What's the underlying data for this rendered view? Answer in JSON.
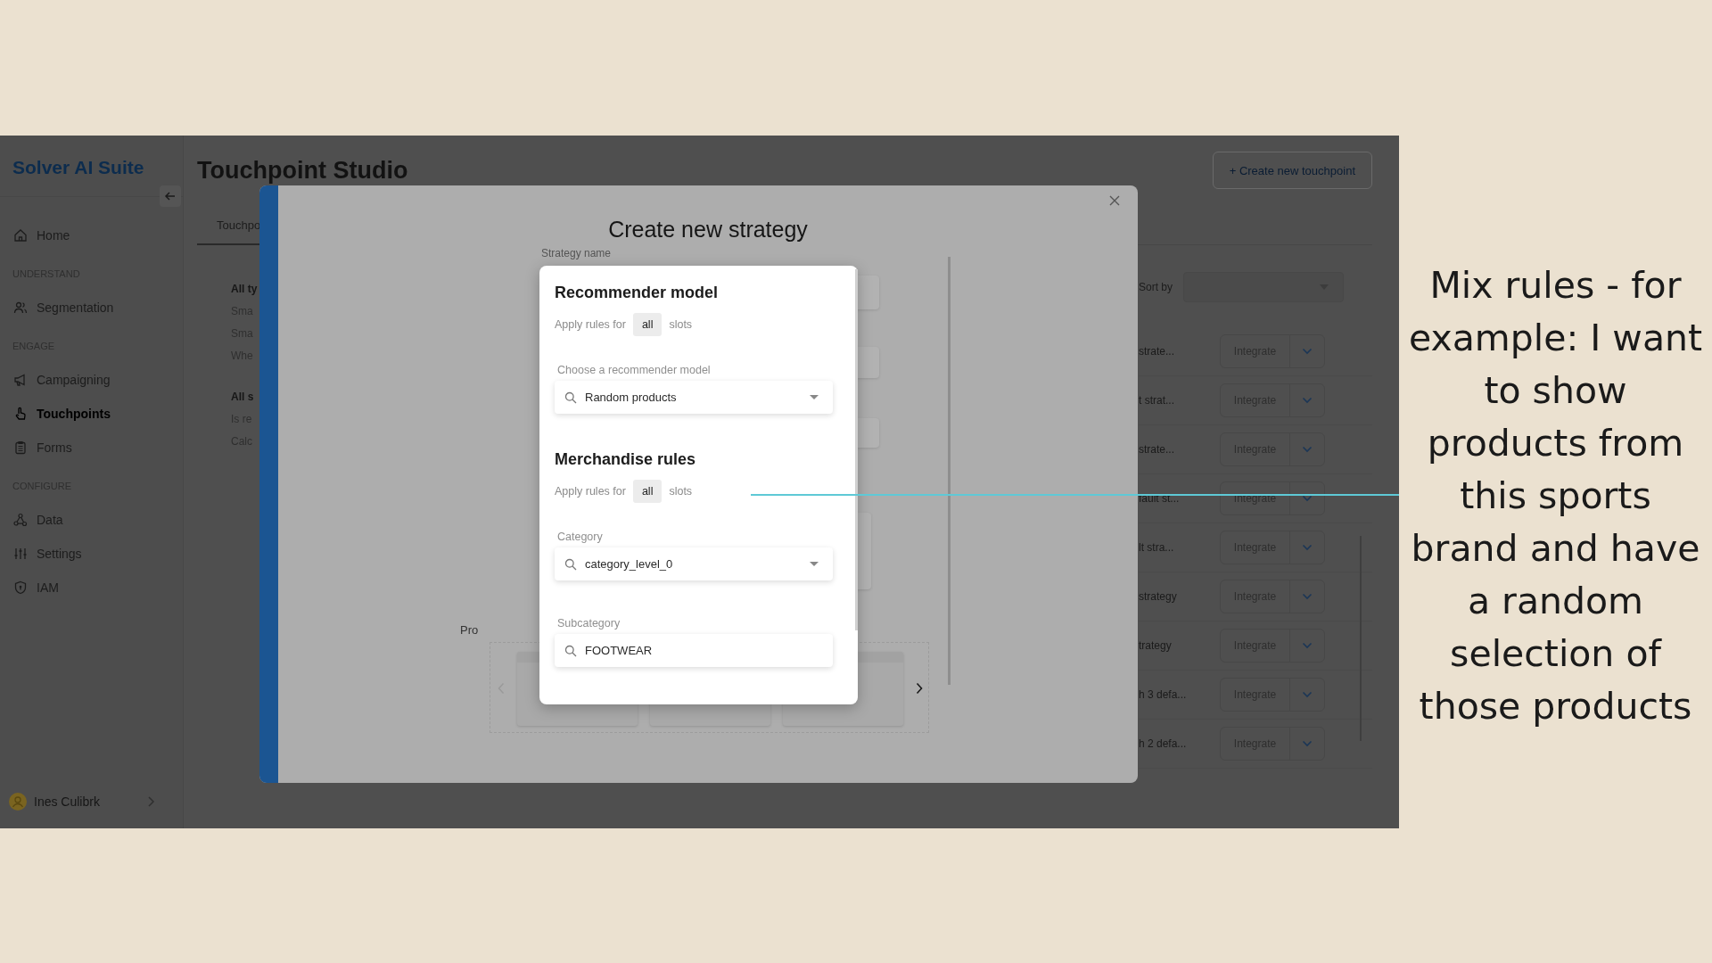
{
  "sidebar": {
    "logo": "Solver AI Suite",
    "items": [
      {
        "kind": "item",
        "label": "Home",
        "selected": false
      },
      {
        "kind": "section",
        "label": "UNDERSTAND"
      },
      {
        "kind": "item",
        "label": "Segmentation",
        "selected": false
      },
      {
        "kind": "section",
        "label": "ENGAGE"
      },
      {
        "kind": "item",
        "label": "Campaigning",
        "selected": false
      },
      {
        "kind": "item",
        "label": "Touchpoints",
        "selected": true
      },
      {
        "kind": "item",
        "label": "Forms",
        "selected": false
      },
      {
        "kind": "section",
        "label": "CONFIGURE"
      },
      {
        "kind": "item",
        "label": "Data",
        "selected": false
      },
      {
        "kind": "item",
        "label": "Settings",
        "selected": false
      },
      {
        "kind": "item",
        "label": "IAM",
        "selected": false
      }
    ],
    "user": {
      "name": "Ines Culibrk"
    }
  },
  "page": {
    "title": "Touchpoint Studio",
    "create_button": "+ Create new touchpoint",
    "tabs": [
      {
        "label": "Touchpo",
        "selected": true
      }
    ],
    "summary_groups": [
      {
        "heading": "All ty",
        "lines": [
          "Sma",
          "Sma",
          "Whe"
        ]
      },
      {
        "heading": "All s",
        "lines": [
          "Is re",
          "Calc"
        ]
      }
    ],
    "sort": {
      "label": "Sort by"
    },
    "rows": [
      {
        "name": "strate...",
        "action": "Integrate"
      },
      {
        "name": "t strat...",
        "action": "Integrate"
      },
      {
        "name": "strate...",
        "action": "Integrate"
      },
      {
        "name": "fault st...",
        "action": "Integrate"
      },
      {
        "name": "lt stra...",
        "action": "Integrate"
      },
      {
        "name": "strategy",
        "action": "Integrate"
      },
      {
        "name": "trategy",
        "action": "Integrate"
      },
      {
        "name": "h 3 defa...",
        "action": "Integrate"
      },
      {
        "name": "h 2 defa...",
        "action": "Integrate"
      }
    ]
  },
  "modal": {
    "title": "Create new strategy",
    "strategy_label": "Strategy name",
    "products_label": "Pro"
  },
  "popup": {
    "sections": [
      {
        "title": "Recommender model",
        "apply": {
          "prefix": "Apply rules for",
          "value": "all",
          "suffix": "slots"
        },
        "fields": [
          {
            "label": "Choose a recommender model",
            "value": "Random products",
            "kind": "select"
          }
        ]
      },
      {
        "title": "Merchandise rules",
        "apply": {
          "prefix": "Apply rules for",
          "value": "all",
          "suffix": "slots"
        },
        "fields": [
          {
            "label": "Category",
            "value": "category_level_0",
            "kind": "select"
          },
          {
            "label": "Subcategory",
            "value": "FOOTWEAR",
            "kind": "search"
          }
        ]
      }
    ]
  },
  "caption": {
    "lines": [
      "Mix rules - for",
      "example: I want",
      "to show",
      "products from",
      "this sports",
      "brand and have",
      "a random",
      "selection of",
      "those products"
    ]
  }
}
